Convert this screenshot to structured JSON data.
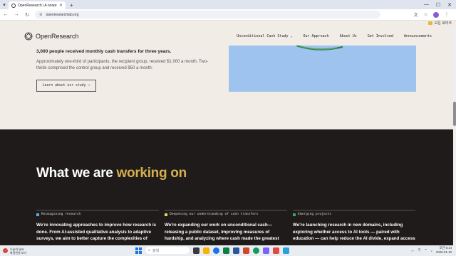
{
  "browser": {
    "tab_title": "OpenResearch | A nonprofit r",
    "url": "openresearchlab.org",
    "bookmarks_label": "모든 북마크"
  },
  "site": {
    "logo_text": "OpenResearch",
    "nav": [
      "Unconditional Cash Study",
      "Our Approach",
      "About Us",
      "Get Involved",
      "Announcements"
    ]
  },
  "study": {
    "lead": "3,000 people received monthly cash transfers for three years.",
    "paragraph": "Approximately one-third of participants, the recipient group, received $1,000 a month. Two-thirds comprised the control group and received $50 a month.",
    "button_label": "Learn about our study →"
  },
  "working": {
    "heading_plain": "What we are ",
    "heading_accent": "working on",
    "columns": [
      {
        "tag": "Reimagining research",
        "color": "#5aa9e6",
        "desc": "We’re innovating approaches to improve how research is done. From AI-assisted qualitative analysis to adaptive surveys, we aim to better capture the complexities of people’s lives and"
      },
      {
        "tag": "Deepening our understanding of cash transfers",
        "color": "#e6d35a",
        "desc": "We’re expanding our work on unconditional cash—releasing a public dataset, improving measures of hardship, and analyzing where cash made the greatest difference—and where"
      },
      {
        "tag": "Emerging projects",
        "color": "#3fa55b",
        "desc": "We’re launching research in new domains, including exploring whether access to AI tools — paired with education — can help reduce the AI divide, expand access to the benefits of"
      }
    ]
  },
  "taskbar": {
    "weather_line1": "오늘의 날씨",
    "weather_line2": "화질변경 보기",
    "search_placeholder": "검색",
    "time": "오전 6:14",
    "date": "2026-01-10",
    "lang": "가"
  }
}
